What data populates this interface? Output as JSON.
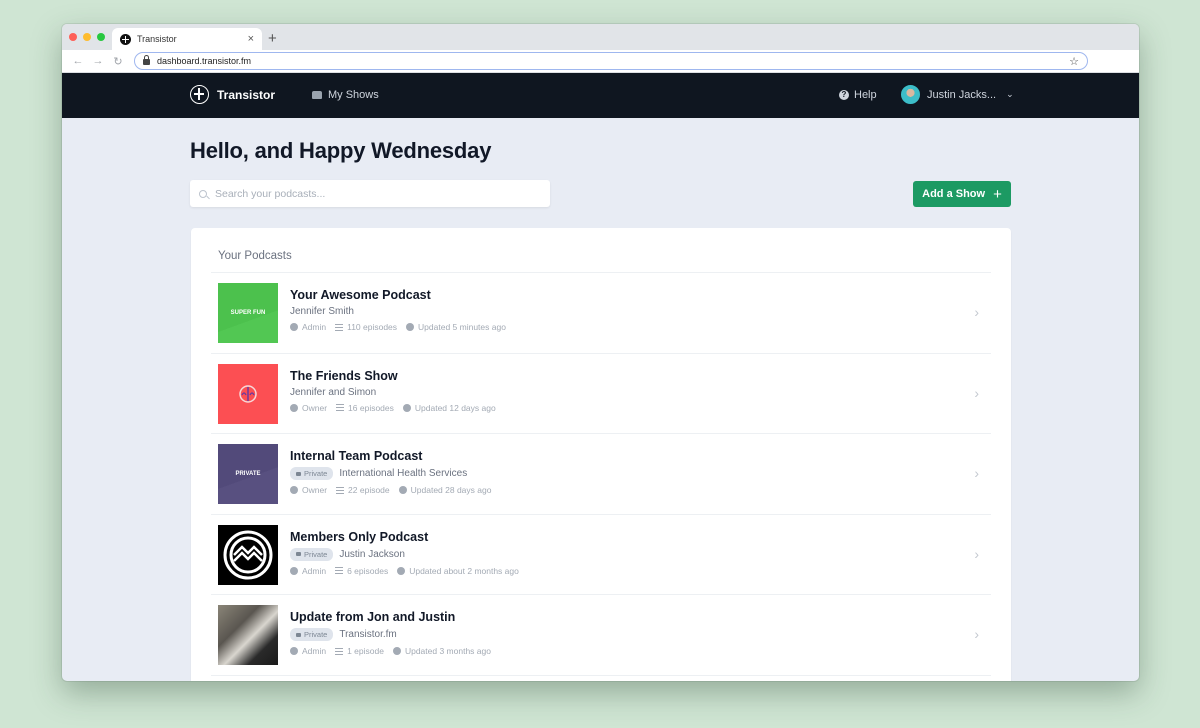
{
  "browser": {
    "tab_title": "Transistor",
    "tab_close": "×",
    "new_tab": "+",
    "url": "dashboard.transistor.fm",
    "back": "←",
    "forward": "→",
    "reload": "↻",
    "bookmark": "☆",
    "traffic_lights": [
      "#fe5f57",
      "#febc2e",
      "#28c840"
    ]
  },
  "header": {
    "logo_text": "Transistor",
    "nav_my_shows": "My Shows",
    "help": "Help",
    "help_icon": "?",
    "user_name": "Justin Jacks...",
    "user_chevron": "⌄"
  },
  "main": {
    "greeting": "Hello, and Happy Wednesday",
    "search_placeholder": "Search your podcasts...",
    "add_show_label": "Add a Show",
    "add_show_icon": "+",
    "accent_color": "#1c9a63"
  },
  "podcasts": {
    "section_title": "Your Podcasts",
    "items": [
      {
        "title": "Your Awesome Podcast",
        "author": "Jennifer Smith",
        "private": false,
        "role": "Admin",
        "episodes": "110 episodes",
        "updated": "Updated 5 minutes ago",
        "art_text": "SUPER FUN",
        "art_color": "#4cc14d"
      },
      {
        "title": "The Friends Show",
        "author": "Jennifer and Simon",
        "private": false,
        "role": "Owner",
        "episodes": "16 episodes",
        "updated": "Updated 12 days ago",
        "art_text": "",
        "art_color": "#fc4f53"
      },
      {
        "title": "Internal Team Podcast",
        "author": "International Health Services",
        "private": true,
        "private_label": "Private",
        "role": "Owner",
        "episodes": "22 episode",
        "updated": "Updated 28 days ago",
        "art_text": "PRIVATE",
        "art_color": "#524a7a"
      },
      {
        "title": "Members Only Podcast",
        "author": "Justin Jackson",
        "private": true,
        "private_label": "Private",
        "role": "Admin",
        "episodes": "6 episodes",
        "updated": "Updated about 2 months ago",
        "art_text": "",
        "art_color": "#000000"
      },
      {
        "title": "Update from Jon and Justin",
        "author": "Transistor.fm",
        "private": true,
        "private_label": "Private",
        "role": "Admin",
        "episodes": "1 episode",
        "updated": "Updated 3 months ago",
        "art_text": "",
        "art_color": "#6b6b6b"
      }
    ]
  }
}
